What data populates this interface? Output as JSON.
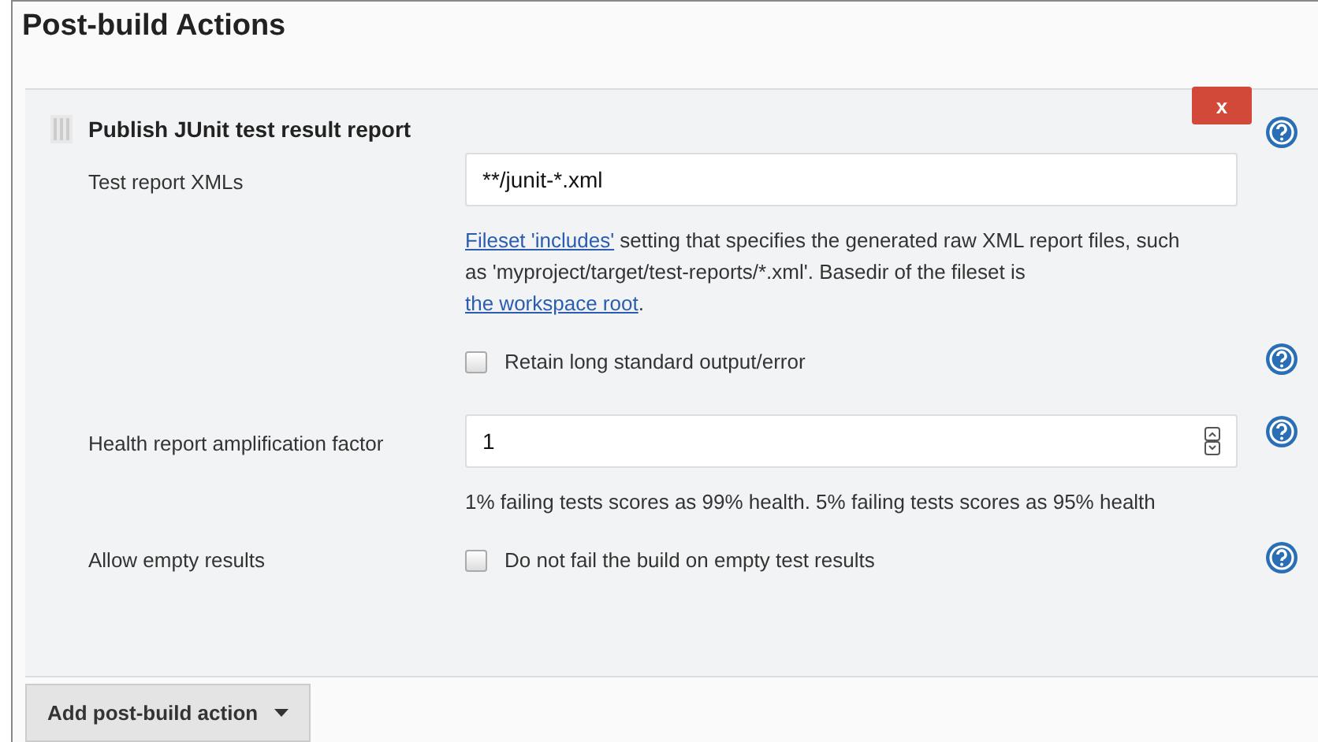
{
  "section_title": "Post-build Actions",
  "action": {
    "title": "Publish JUnit test result report",
    "delete_label": "x",
    "fields": [
      {
        "kind": "text",
        "label": "Test report XMLs",
        "value": "**/junit-*.xml",
        "help": false,
        "description": [
          {
            "kind": "link",
            "text": "Fileset 'includes'"
          },
          {
            "kind": "text",
            "text": " setting that specifies the generated raw XML report files, such as 'myproject/target/test-reports/*.xml'. Basedir of the fileset is "
          },
          {
            "kind": "link",
            "text": "the workspace root"
          },
          {
            "kind": "text",
            "text": "."
          }
        ]
      },
      {
        "kind": "checkbox",
        "text": "Retain long standard output/error",
        "checked": false,
        "help": true
      },
      {
        "kind": "number",
        "label": "Health report amplification factor",
        "value": "1",
        "help": true,
        "description": [
          {
            "kind": "text",
            "text": "1% failing tests scores as 99% health. 5% failing tests scores as 95% health"
          }
        ]
      },
      {
        "kind": "checkbox",
        "label": "Allow empty results",
        "text": "Do not fail the build on empty test results",
        "checked": false,
        "help": true
      }
    ]
  },
  "add_button": {
    "label": "Add post-build action"
  }
}
